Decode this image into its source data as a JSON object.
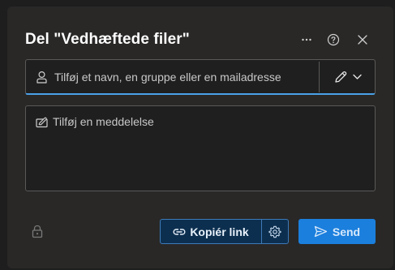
{
  "dialog": {
    "title": "Del \"Vedhæftede filer\""
  },
  "header": {
    "more_icon": "more-horizontal-icon",
    "help_icon": "question-circle-icon",
    "close_icon": "close-icon"
  },
  "people_field": {
    "placeholder": "Tilføj et navn, en gruppe eller en mailadresse",
    "value": "",
    "permission_icon": "pencil-icon"
  },
  "message_field": {
    "placeholder": "Tilføj en meddelelse",
    "value": ""
  },
  "footer": {
    "copy_link_label": "Kopiér link",
    "send_label": "Send"
  },
  "colors": {
    "background": "#292827",
    "accent": "#1b7fdd",
    "focus_border": "#4aa1e8",
    "copy_link_bg": "#0d2f4f"
  }
}
